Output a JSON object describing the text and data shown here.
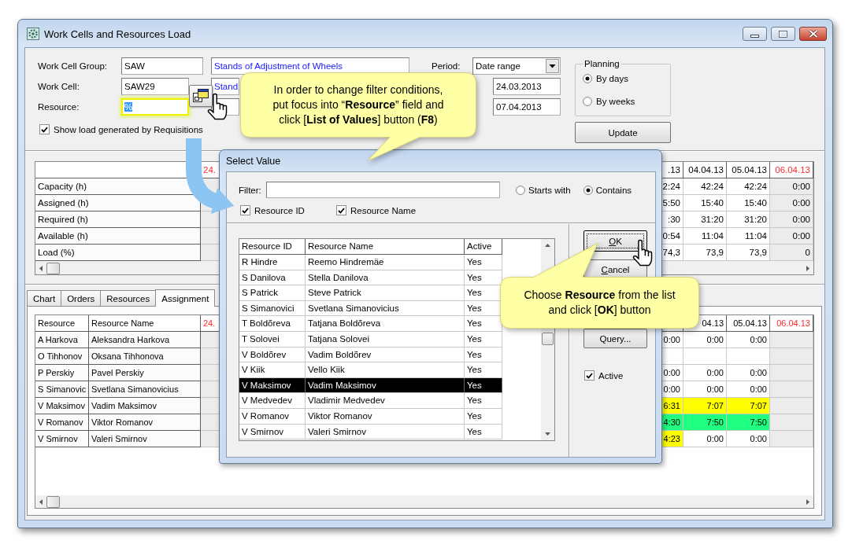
{
  "window": {
    "title": "Work Cells and Resources Load"
  },
  "filters": {
    "fields": [
      {
        "label": "Work Cell Group:",
        "value": "SAW",
        "description": "Stands of Adjustment of Wheels",
        "focused": false
      },
      {
        "label": "Work Cell:",
        "value": "SAW29",
        "description": "Stand",
        "focused": false
      },
      {
        "label": "Resource:",
        "value": "%",
        "focused": true
      }
    ],
    "show_requisitions": {
      "label": "Show load generated by Requisitions",
      "checked": true
    }
  },
  "period": {
    "label": "Period:",
    "value": "Date range",
    "dates": [
      "24.03.2013",
      "07.04.2013"
    ]
  },
  "planning": {
    "title": "Planning",
    "options": [
      {
        "label": "By days",
        "selected": true
      },
      {
        "label": "By weeks",
        "selected": false
      }
    ]
  },
  "update_button": {
    "label": "Update"
  },
  "load_table": {
    "row_labels": [
      "Capacity (h)",
      "Assigned (h)",
      "Required (h)",
      "Available (h)",
      "Load (%)"
    ],
    "left_column": {
      "header": "24.",
      "weekend": true
    },
    "columns": [
      {
        "header": ".13",
        "weekend": false,
        "values": [
          "2:24",
          "5:50",
          ":30",
          "0:54",
          "74,3"
        ]
      },
      {
        "header": "04.04.13",
        "weekend": false,
        "values": [
          "42:24",
          "15:40",
          "31:20",
          "11:04",
          "73,9"
        ]
      },
      {
        "header": "05.04.13",
        "weekend": false,
        "values": [
          "42:24",
          "15:40",
          "31:20",
          "11:04",
          "73,9"
        ]
      },
      {
        "header": "06.04.13",
        "weekend": true,
        "values": [
          "0:00",
          "0:00",
          "0:00",
          "0:00",
          "0"
        ]
      }
    ]
  },
  "tabs": [
    {
      "label": "Chart",
      "selected": false
    },
    {
      "label": "Orders",
      "selected": false
    },
    {
      "label": "Resources",
      "selected": false
    },
    {
      "label": "Assignment",
      "selected": true
    }
  ],
  "assignments": {
    "headers": [
      "Resource",
      "Resource Name"
    ],
    "left_column": {
      "header": "24.",
      "weekend": true
    },
    "date_columns": [
      {
        "weekend": false
      },
      {
        "header": "04.13",
        "weekend": false
      },
      {
        "header": "05.04.13",
        "weekend": false
      },
      {
        "header": "06.04.13",
        "weekend": true
      }
    ],
    "rows": [
      {
        "resource": "A Harkova",
        "name": "Aleksandra Harkova",
        "cells": [
          {
            "text": "0:00"
          },
          {
            "text": "0:00"
          },
          {
            "text": "0:00"
          }
        ]
      },
      {
        "resource": "O Tihhonov",
        "name": "Oksana Tihhonova"
      },
      {
        "resource": "P Perskiy",
        "name": "Pavel Perskiy",
        "cells": [
          {
            "text": "0:00"
          },
          {
            "text": "0:00"
          },
          {
            "text": "0:00"
          }
        ]
      },
      {
        "resource": "S Simanovic",
        "name": "Svetlana Simanovicius",
        "cells": [
          {
            "text": "0:00"
          },
          {
            "text": "0:00"
          },
          {
            "text": "0:00"
          }
        ]
      },
      {
        "resource": "V Maksimov",
        "name": "Vadim Maksimov",
        "cells": [
          {
            "text": "6:31",
            "color": "#ffff00"
          },
          {
            "text": "7:07",
            "color": "#ffff00"
          },
          {
            "text": "7:07",
            "color": "#ffff00"
          }
        ]
      },
      {
        "resource": "V Romanov",
        "name": "Viktor Romanov",
        "cells": [
          {
            "text": "4:30",
            "color": "#20ff80"
          },
          {
            "text": "7:50",
            "color": "#20ff80"
          },
          {
            "text": "7:50",
            "color": "#20ff80"
          }
        ]
      },
      {
        "resource": "V Smirnov",
        "name": "Valeri Smirnov",
        "cells": [
          {
            "text": "4:23",
            "color": "#ffff00"
          },
          {
            "text": "0:00"
          },
          {
            "text": "0:00"
          }
        ]
      }
    ]
  },
  "dialog": {
    "title": "Select Value",
    "filter_label": "Filter:",
    "match_options": [
      {
        "label": "Starts with",
        "selected": false
      },
      {
        "label": "Contains",
        "selected": true
      }
    ],
    "search_in": [
      {
        "label": "Resource ID",
        "checked": true
      },
      {
        "label": "Resource Name",
        "checked": true
      }
    ],
    "columns": [
      "Resource ID",
      "Resource Name",
      "Active"
    ],
    "rows": [
      {
        "id": "R Hindre",
        "name": "Reemo Hindremäe",
        "active": "Yes",
        "selected": false
      },
      {
        "id": "S Danilova",
        "name": "Stella Danilova",
        "active": "Yes",
        "selected": false
      },
      {
        "id": "S Patrick",
        "name": "Steve Patrick",
        "active": "Yes",
        "selected": false
      },
      {
        "id": "S Simanovici",
        "name": "Svetlana Simanovicius",
        "active": "Yes",
        "selected": false
      },
      {
        "id": "T Boldõreva",
        "name": "Tatjana Boldõreva",
        "active": "Yes",
        "selected": false
      },
      {
        "id": "T Solovei",
        "name": "Tatjana Solovei",
        "active": "Yes",
        "selected": false
      },
      {
        "id": "V Boldõrev",
        "name": "Vadim Boldõrev",
        "active": "Yes",
        "selected": false
      },
      {
        "id": "V Kiik",
        "name": "Vello Kiik",
        "active": "Yes",
        "selected": false
      },
      {
        "id": "V Maksimov",
        "name": "Vadim Maksimov",
        "active": "Yes",
        "selected": true
      },
      {
        "id": "V Medvedev",
        "name": "Vladimir Medvedev",
        "active": "Yes",
        "selected": false
      },
      {
        "id": "V Romanov",
        "name": "Viktor Romanov",
        "active": "Yes",
        "selected": false
      },
      {
        "id": "V Smirnov",
        "name": "Valeri Smirnov",
        "active": "Yes",
        "selected": false
      }
    ],
    "buttons": [
      {
        "label": "OK",
        "focused": true,
        "underline_first": true
      },
      {
        "label": "Cancel",
        "focused": false,
        "underline_first": true
      },
      {
        "label": "Query...",
        "focused": false,
        "underline_first": false
      }
    ],
    "active_filter": {
      "label": "Active",
      "checked": true
    }
  },
  "callouts": [
    {
      "text": "In order to change filter conditions,\nput focus into “**Resource**” field and\nclick [**List of Values**] button (**F8**)"
    },
    {
      "text": "Choose **Resource** from the list\nand click [**OK**] button"
    }
  ]
}
